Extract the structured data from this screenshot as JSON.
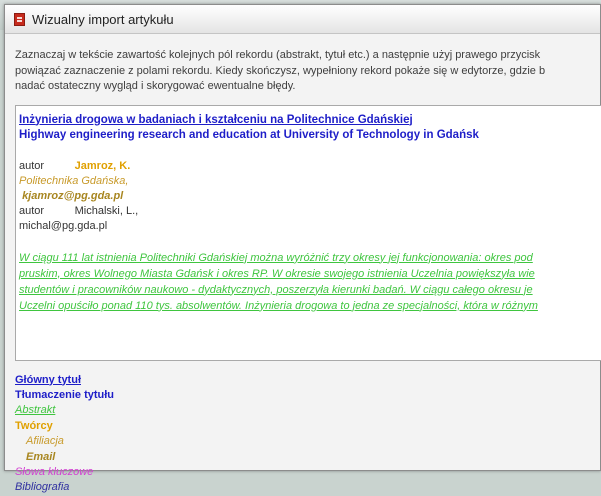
{
  "window": {
    "title": "Wizualny import artykułu"
  },
  "instructions": [
    "Zaznaczaj w tekście zawartość kolejnych pól rekordu (abstrakt, tytuł etc.) a następnie użyj prawego przycisk",
    "powiązać zaznaczenie z polami rekordu. Kiedy skończysz, wypełniony rekord pokaże się w edytorze, gdzie b",
    "nadać ostateczny wygląd i skorygować ewentualne błędy."
  ],
  "editor": {
    "title_line": "Inżynieria drogowa w badaniach i kształceniu na Politechnice Gdańskiej",
    "translation_line": "Highway engineering research and education at University of Technology in Gdańsk",
    "author1_label": "autor",
    "author1_name": "Jamroz, K.",
    "affiliation": "Politechnika Gdańska,",
    "email1": "kjamroz@pg.gda.pl",
    "author2_label": "autor",
    "author2_name": "Michalski, L.,",
    "email2": "michal@pg.gda.pl",
    "abstract_lines": [
      "W ciągu 111 lat istnienia Politechniki Gdańskiej można wyróżnić trzy okresy jej funkcjonowania: okres pod",
      "pruskim, okres Wolnego Miasta Gdańsk i okres RP. W okresie swojego istnienia Uczelnia powiększyła wie",
      "studentów i pracowników naukowo - dydaktycznych, poszerzyła kierunki badań. W ciągu całego okresu je",
      "Uczelni opuściło ponad 110 tys. absolwentów. Inżynieria drogowa to jedna ze specjalności, która w różnym"
    ]
  },
  "legend": {
    "main_title": "Główny tytuł",
    "title_translation": "Tłumaczenie tytułu",
    "abstract": "Abstrakt",
    "creators": "Twórcy",
    "affiliation": "Afiliacja",
    "email": "Email",
    "keywords": "Słowa kluczowe",
    "bibliography": "Bibliografia"
  },
  "colors": {
    "title": "#1e1ec8",
    "abstract": "#3fc53f",
    "creators": "#e0a000",
    "affiliation": "#c89a2a",
    "email": "#a88620",
    "keywords": "#d23fd2",
    "bibliography": "#3030a0",
    "app_icon": "#c62a1c"
  }
}
